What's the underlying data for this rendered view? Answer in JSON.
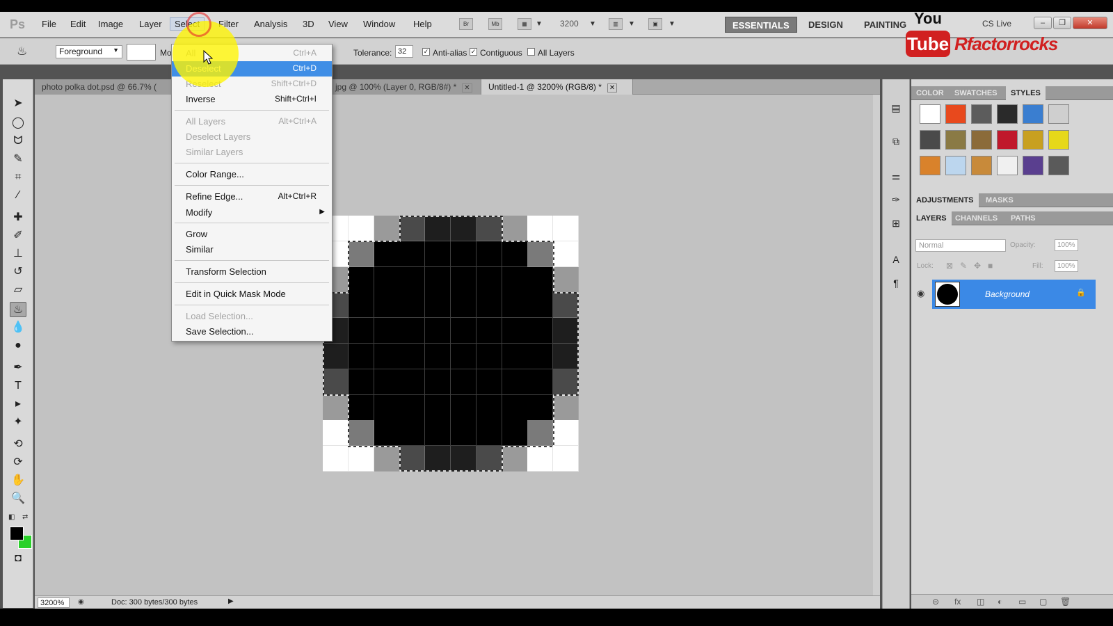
{
  "app": {
    "logo": "Ps",
    "menu": [
      "File",
      "Edit",
      "Image",
      "Layer",
      "Select",
      "Filter",
      "Analysis",
      "3D",
      "View",
      "Window",
      "Help"
    ],
    "bar_icons": [
      "Br",
      "Mb"
    ],
    "zoom": "3200",
    "workspaces": [
      "ESSENTIALS",
      "DESIGN",
      "PAINTING"
    ],
    "cs_live": "CS Live"
  },
  "options": {
    "fill_source": "Foreground",
    "mode_label": "Mo",
    "tolerance_label": "Tolerance:",
    "tolerance": "32",
    "anti_alias": "Anti-alias",
    "contiguous": "Contiguous",
    "all_layers": "All Layers",
    "anti_alias_checked": true,
    "contiguous_checked": true,
    "all_layers_checked": false
  },
  "tabs": [
    {
      "label": "photo polka dot.psd @ 66.7% (",
      "active": false
    },
    {
      "label": "jpg @ 100% (Layer 0, RGB/8#) *",
      "active": false
    },
    {
      "label": "Untitled-1 @ 3200% (RGB/8) *",
      "active": true
    }
  ],
  "select_menu": {
    "items": [
      {
        "label": "All",
        "shortcut": "Ctrl+A",
        "state": "disabled"
      },
      {
        "label": "Deselect",
        "shortcut": "Ctrl+D",
        "state": "highlighted"
      },
      {
        "label": "Reselect",
        "shortcut": "Shift+Ctrl+D",
        "state": "disabled"
      },
      {
        "label": "Inverse",
        "shortcut": "Shift+Ctrl+I",
        "state": "enabled"
      },
      {
        "label": "All Layers",
        "shortcut": "Alt+Ctrl+A",
        "state": "disabled"
      },
      {
        "label": "Deselect Layers",
        "shortcut": "",
        "state": "disabled"
      },
      {
        "label": "Similar Layers",
        "shortcut": "",
        "state": "disabled"
      },
      {
        "label": "Color Range...",
        "shortcut": "",
        "state": "enabled"
      },
      {
        "label": "Refine Edge...",
        "shortcut": "Alt+Ctrl+R",
        "state": "enabled"
      },
      {
        "label": "Modify",
        "shortcut": "",
        "state": "enabled",
        "submenu": true
      },
      {
        "label": "Grow",
        "shortcut": "",
        "state": "enabled"
      },
      {
        "label": "Similar",
        "shortcut": "",
        "state": "enabled"
      },
      {
        "label": "Transform Selection",
        "shortcut": "",
        "state": "enabled"
      },
      {
        "label": "Edit in Quick Mask Mode",
        "shortcut": "",
        "state": "enabled"
      },
      {
        "label": "Load Selection...",
        "shortcut": "",
        "state": "disabled"
      },
      {
        "label": "Save Selection...",
        "shortcut": "",
        "state": "enabled"
      }
    ]
  },
  "canvas": {
    "grid": [
      [
        "#ffffff",
        "#ffffff",
        "#9a9a9a",
        "#4a4a4a",
        "#1e1e1e",
        "#1e1e1e",
        "#4a4a4a",
        "#9a9a9a",
        "#ffffff",
        "#ffffff"
      ],
      [
        "#ffffff",
        "#7a7a7a",
        "#000000",
        "#000000",
        "#000000",
        "#000000",
        "#000000",
        "#000000",
        "#7a7a7a",
        "#ffffff"
      ],
      [
        "#9a9a9a",
        "#000000",
        "#000000",
        "#000000",
        "#000000",
        "#000000",
        "#000000",
        "#000000",
        "#000000",
        "#9a9a9a"
      ],
      [
        "#4a4a4a",
        "#000000",
        "#000000",
        "#000000",
        "#000000",
        "#000000",
        "#000000",
        "#000000",
        "#000000",
        "#4a4a4a"
      ],
      [
        "#1e1e1e",
        "#000000",
        "#000000",
        "#000000",
        "#000000",
        "#000000",
        "#000000",
        "#000000",
        "#000000",
        "#1e1e1e"
      ],
      [
        "#1e1e1e",
        "#000000",
        "#000000",
        "#000000",
        "#000000",
        "#000000",
        "#000000",
        "#000000",
        "#000000",
        "#1e1e1e"
      ],
      [
        "#4a4a4a",
        "#000000",
        "#000000",
        "#000000",
        "#000000",
        "#000000",
        "#000000",
        "#000000",
        "#000000",
        "#4a4a4a"
      ],
      [
        "#9a9a9a",
        "#000000",
        "#000000",
        "#000000",
        "#000000",
        "#000000",
        "#000000",
        "#000000",
        "#000000",
        "#9a9a9a"
      ],
      [
        "#ffffff",
        "#7a7a7a",
        "#000000",
        "#000000",
        "#000000",
        "#000000",
        "#000000",
        "#000000",
        "#7a7a7a",
        "#ffffff"
      ],
      [
        "#ffffff",
        "#ffffff",
        "#9a9a9a",
        "#4a4a4a",
        "#1e1e1e",
        "#1e1e1e",
        "#4a4a4a",
        "#9a9a9a",
        "#ffffff",
        "#ffffff"
      ]
    ]
  },
  "status": {
    "zoom": "3200%",
    "doc_info": "Doc: 300 bytes/300 bytes"
  },
  "panels": {
    "top_tabs": [
      "COLOR",
      "SWATCHES",
      "STYLES"
    ],
    "active_top_tab": "STYLES",
    "style_swatches": [
      "#ffffff",
      "#e8491d",
      "#5c5c5c",
      "#2a2a2a",
      "#3a7ed0",
      "#cfcfcf",
      "#4a4a4a",
      "#8a7a45",
      "#8b6b3a",
      "#c0182b",
      "#c8a020",
      "#e6d81a",
      "#d9822b",
      "#bcd6ee",
      "#c88a3a",
      "#f0f0f0",
      "#5a3f8f",
      "#5a5a5a"
    ],
    "mid_tabs": [
      "ADJUSTMENTS",
      "MASKS"
    ],
    "layer_tabs": [
      "LAYERS",
      "CHANNELS",
      "PATHS"
    ],
    "blend_mode": "Normal",
    "opacity_label": "Opacity:",
    "opacity": "100%",
    "lock_label": "Lock:",
    "fill_label": "Fill:",
    "fill": "100%",
    "layer_name": "Background"
  },
  "watermark": {
    "you": "You",
    "tube": "Tube",
    "channel": "Rfactorrocks"
  },
  "colors": {
    "foreground": "#000000",
    "background": "#2ad12a",
    "highlight": "#3f8ee6"
  }
}
